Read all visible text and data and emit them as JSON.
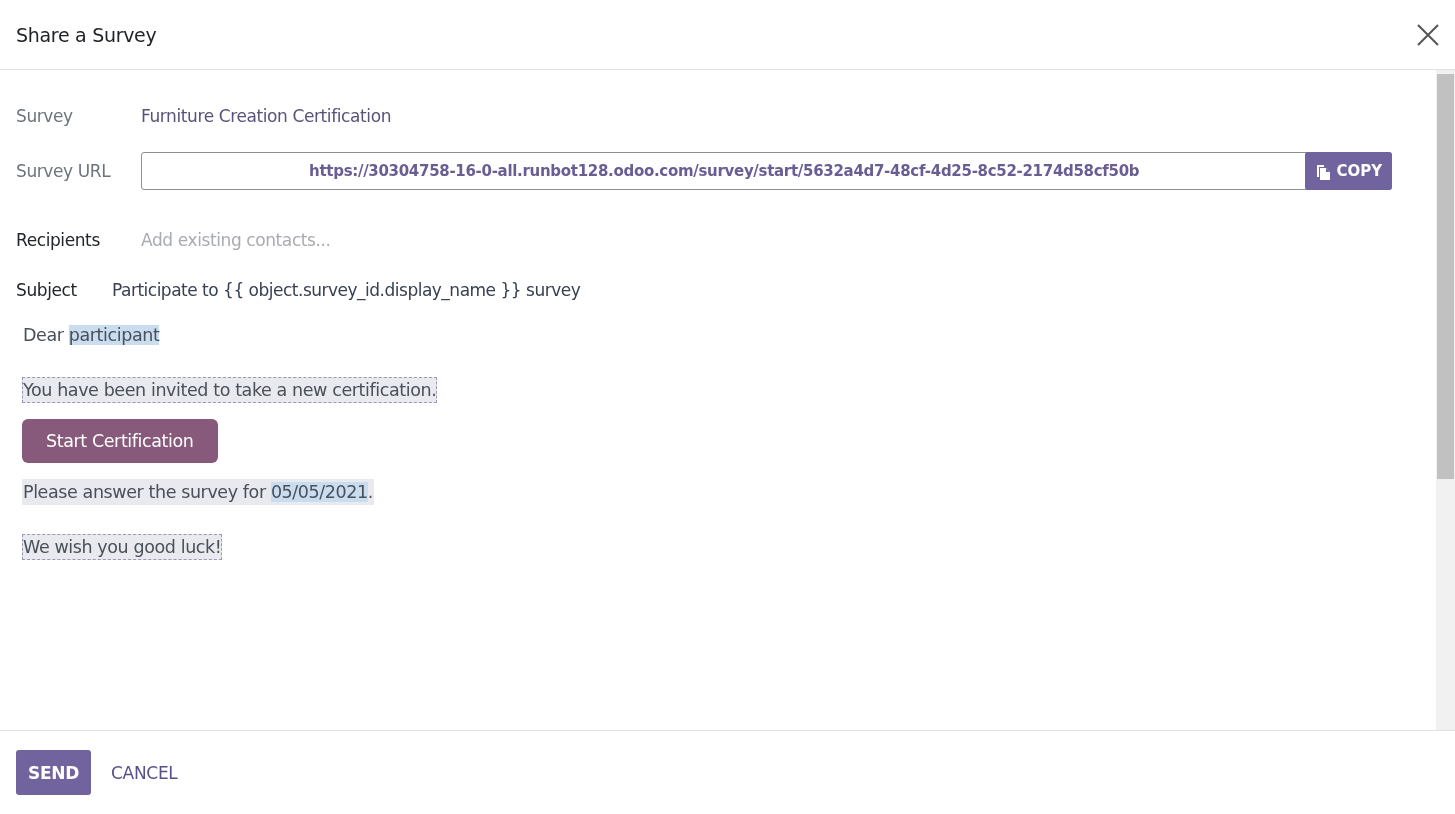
{
  "dialog": {
    "title": "Share a Survey"
  },
  "fields": [
    {
      "kind": "text",
      "label": "Survey",
      "value": "Furniture Creation Certification"
    },
    {
      "kind": "url",
      "label": "Survey URL",
      "value": "https://30304758-16-0-all.runbot128.odoo.com/survey/start/5632a4d7-48cf-4d25-8c52-2174d58cf50b",
      "button": "COPY"
    },
    {
      "kind": "tags",
      "label": "Recipients",
      "placeholder": "Add existing contacts..."
    },
    {
      "kind": "subject",
      "label": "Subject",
      "value": "Participate to {{ object.survey_id.display_name }} survey"
    }
  ],
  "body": [
    {
      "kind": "text",
      "framed": false,
      "shaded": false,
      "parts": [
        {
          "text": "Dear ",
          "highlight": false
        },
        {
          "text": "participant",
          "highlight": true
        }
      ]
    },
    {
      "kind": "text",
      "framed": true,
      "shaded": true,
      "parts": [
        {
          "text": "You have been invited to take a new certification.",
          "highlight": false
        }
      ]
    },
    {
      "kind": "button",
      "label": "Start Certification"
    },
    {
      "kind": "text",
      "framed": false,
      "shaded": true,
      "parts": [
        {
          "text": "Please answer the survey for ",
          "highlight": false
        },
        {
          "text": "05/05/2021",
          "highlight": true
        },
        {
          "text": ".",
          "highlight": false
        }
      ]
    },
    {
      "kind": "text",
      "framed": true,
      "shaded": true,
      "parts": [
        {
          "text": "We wish you good luck!",
          "highlight": false
        }
      ]
    }
  ],
  "footer": {
    "buttons": [
      {
        "label": "SEND",
        "primary": true
      },
      {
        "label": "CANCEL",
        "primary": false
      }
    ]
  }
}
